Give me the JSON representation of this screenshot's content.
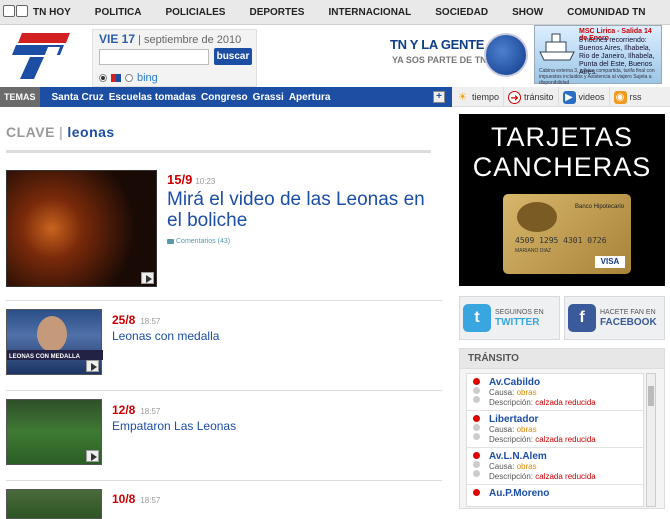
{
  "topnav": {
    "items": [
      "TN HOY",
      "POLITICA",
      "POLICIALES",
      "DEPORTES",
      "INTERNACIONAL",
      "SOCIEDAD",
      "SHOW",
      "COMUNIDAD TN"
    ]
  },
  "search": {
    "day": "VIE 17",
    "date_rest": "| septiembre de 2010",
    "button": "buscar",
    "engine": "bing"
  },
  "promo": {
    "line1": "TN Y LA GENTE",
    "line2": "YA SOS PARTE DE TN"
  },
  "header_ad": {
    "title": "MSC Lirica - Salida 14 de Enero",
    "body": "8 noches recorriendo: Buenos Aires, Ilhabela, Rio de Janeiro, Ilhabela, Punta del Este, Buenos Aires.",
    "fine": "Cabina externa 3, cabina compartida, tarifa final con impuestos incluidos y Asistencia al viajero Sujeta a disponibilidad"
  },
  "temas": {
    "label": "TEMAS",
    "items": [
      "Santa Cruz",
      "Escuelas tomadas",
      "Congreso",
      "Grassi",
      "Apertura"
    ]
  },
  "tools": [
    "tiempo",
    "tránsito",
    "videos",
    "rss"
  ],
  "clave": {
    "prefix": "CLAVE",
    "term": "leonas"
  },
  "featured": {
    "date": "15/9",
    "time": "10:23",
    "title": "Mirá el video de las Leonas en el boliche",
    "comments": "Comentarios (43)"
  },
  "items": [
    {
      "date": "25/8",
      "time": "18:57",
      "title": "Leonas con medalla",
      "caption": "LEONAS CON MEDALLA"
    },
    {
      "date": "12/8",
      "time": "18:57",
      "title": "Empataron Las Leonas"
    },
    {
      "date": "10/8",
      "time": "18:57"
    }
  ],
  "side_ad": {
    "headline1": "TARJETAS",
    "headline2": "CANCHERAS",
    "card_number": "4509 1295 4301 0726",
    "holder": "MARIANO DIAZ",
    "bank": "Banco Hipotecario",
    "brand": "VISA"
  },
  "social": {
    "twitter_small": "SEGUINOS EN",
    "twitter_big": "TWITTER",
    "facebook_small": "HACETE FAN EN",
    "facebook_big": "FACEBOOK"
  },
  "transito": {
    "header": "TRÁNSITO",
    "cause_label": "Causa:",
    "desc_label": "Descripción:",
    "entries": [
      {
        "street": "Av.Cabildo",
        "cause": "obras",
        "desc": "calzada reducida"
      },
      {
        "street": "Libertador",
        "cause": "obras",
        "desc": "calzada reducida"
      },
      {
        "street": "Av.L.N.Alem",
        "cause": "obras",
        "desc": "calzada reducida"
      },
      {
        "street": "Au.P.Moreno"
      }
    ]
  },
  "colors": {
    "brand_blue": "#1c4ea3",
    "accent_red": "#cc0000",
    "cause_orange": "#e08a00"
  }
}
